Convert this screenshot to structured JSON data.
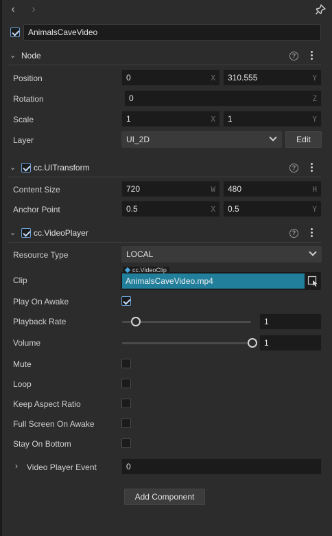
{
  "nav": {
    "back": "‹",
    "forward": "›"
  },
  "node_name": {
    "checked": true,
    "value": "AnimalsCaveVideo"
  },
  "sections": {
    "node": {
      "title": "Node",
      "position": {
        "label": "Position",
        "x": "0",
        "x_axis": "X",
        "y": "310.555",
        "y_axis": "Y"
      },
      "rotation": {
        "label": "Rotation",
        "z": "0",
        "z_axis": "Z"
      },
      "scale": {
        "label": "Scale",
        "x": "1",
        "x_axis": "X",
        "y": "1",
        "y_axis": "Y"
      },
      "layer": {
        "label": "Layer",
        "value": "UI_2D",
        "edit_label": "Edit"
      }
    },
    "uitransform": {
      "title": "cc.UITransform",
      "enabled": true,
      "content_size": {
        "label": "Content Size",
        "w": "720",
        "w_axis": "W",
        "h": "480",
        "h_axis": "H"
      },
      "anchor_point": {
        "label": "Anchor Point",
        "x": "0.5",
        "x_axis": "X",
        "y": "0.5",
        "y_axis": "Y"
      }
    },
    "videoplayer": {
      "title": "cc.VideoPlayer",
      "enabled": true,
      "resource_type": {
        "label": "Resource Type",
        "value": "LOCAL"
      },
      "clip": {
        "label": "Clip",
        "asset_type": "cc.VideoClip",
        "value": "AnimalsCaveVideo.mp4"
      },
      "play_on_awake": {
        "label": "Play On Awake",
        "checked": true
      },
      "playback_rate": {
        "label": "Playback Rate",
        "value": "1",
        "slider_fraction": 0.1
      },
      "volume": {
        "label": "Volume",
        "value": "1",
        "slider_fraction": 1.0
      },
      "mute": {
        "label": "Mute",
        "checked": false
      },
      "loop": {
        "label": "Loop",
        "checked": false
      },
      "keep_aspect_ratio": {
        "label": "Keep Aspect Ratio",
        "checked": false
      },
      "full_screen_on_awake": {
        "label": "Full Screen On Awake",
        "checked": false
      },
      "stay_on_bottom": {
        "label": "Stay On Bottom",
        "checked": false
      },
      "video_player_event": {
        "label": "Video Player Event",
        "value": "0"
      }
    }
  },
  "add_component": {
    "label": "Add Component"
  },
  "icons": {
    "help": "?",
    "colors": {
      "accent": "#227f9c",
      "check": "#6aa0d8",
      "field_bg": "#1b1b1b",
      "panel_bg": "#2c2c2c"
    }
  }
}
